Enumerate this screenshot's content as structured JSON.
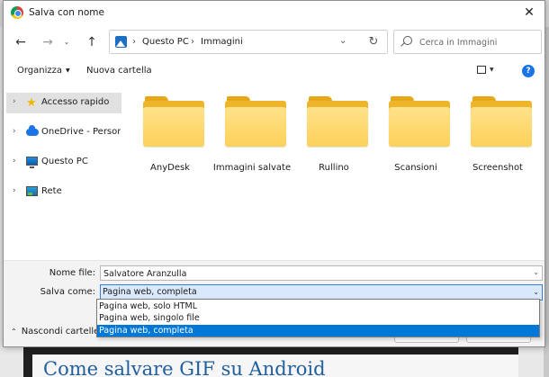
{
  "window": {
    "title": "Salva con nome",
    "close_glyph": "✕"
  },
  "nav": {
    "back_glyph": "←",
    "forward_glyph": "→",
    "recent_glyph": "⌄",
    "up_glyph": "↑",
    "breadcrumb": [
      "Questo PC",
      "Immagini"
    ],
    "breadcrumb_separator": "›",
    "address_dropdown_glyph": "⌄",
    "refresh_glyph": "↻",
    "search_placeholder": "Cerca in Immagini"
  },
  "toolbar": {
    "organize_label": "Organizza",
    "new_folder_label": "Nuova cartella",
    "caret_glyph": "▼",
    "help_glyph": "?"
  },
  "sidebar": {
    "chevron_glyph": "›",
    "items": [
      {
        "label": "Accesso rapido",
        "icon": "star-icon",
        "selected": true
      },
      {
        "label": "OneDrive - Personal",
        "icon": "cloud-icon",
        "selected": false
      },
      {
        "label": "Questo PC",
        "icon": "monitor-icon",
        "selected": false
      },
      {
        "label": "Rete",
        "icon": "network-icon",
        "selected": false
      }
    ],
    "star_glyph": "★"
  },
  "folders": [
    {
      "name": "AnyDesk"
    },
    {
      "name": "Immagini salvate"
    },
    {
      "name": "Rullino"
    },
    {
      "name": "Scansioni"
    },
    {
      "name": "Screenshot"
    }
  ],
  "form": {
    "filename_label": "Nome file:",
    "filename_value": "Salvatore Aranzulla",
    "savetype_label": "Salva come:",
    "savetype_value": "Pagina web, completa",
    "dropdown_glyph": "⌄"
  },
  "type_options": [
    {
      "label": "Pagina web, solo HTML",
      "selected": false
    },
    {
      "label": "Pagina web, singolo file",
      "selected": false
    },
    {
      "label": "Pagina web, completa",
      "selected": true
    }
  ],
  "footer": {
    "hide_folders_label": "Nascondi cartelle",
    "hide_caret_glyph": "⌃"
  },
  "background_page": {
    "article_heading": "Come salvare GIF su Android"
  },
  "colors": {
    "accent": "#0078d7",
    "folder": "#fdd15a",
    "link": "#1f5f9e"
  }
}
